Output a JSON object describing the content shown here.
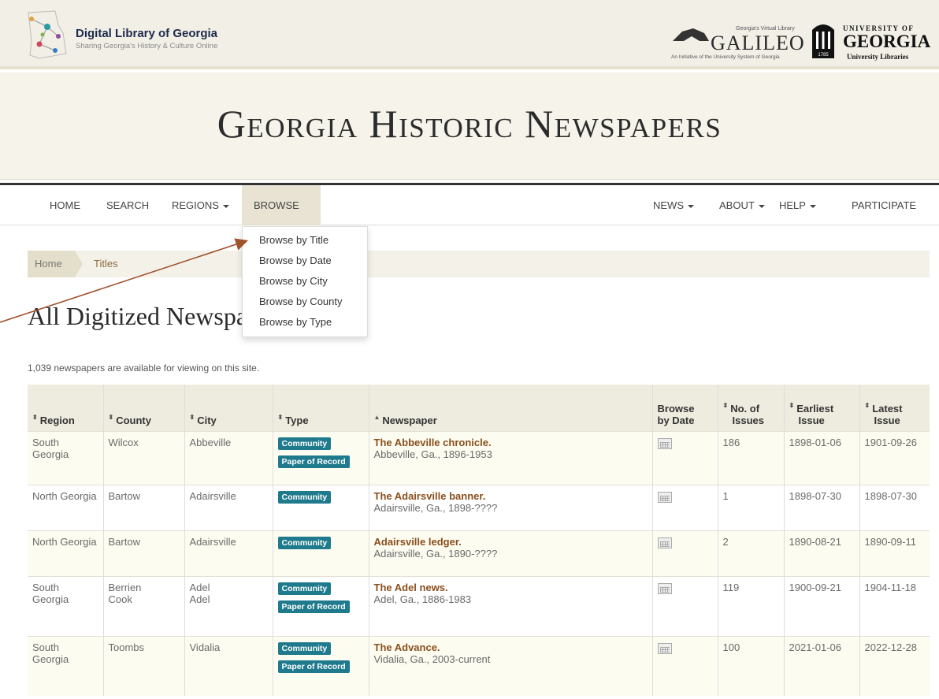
{
  "header": {
    "dlg_name": "Digital Library of Georgia",
    "dlg_tagline": "Sharing Georgia's History & Culture Online",
    "galileo_top": "Georgia's Virtual Library",
    "galileo_word": "GALILEO",
    "galileo_sub": "An Initiative of the University System of Georgia",
    "uga_univ": "UNIVERSITY OF",
    "uga_geo": "GEORGIA",
    "uga_lib": "University Libraries",
    "uga_year": "1785"
  },
  "banner": {
    "title": "Georgia Historic Newspapers"
  },
  "nav": {
    "left": [
      {
        "label": "HOME"
      },
      {
        "label": "SEARCH"
      },
      {
        "label": "REGIONS"
      },
      {
        "label": "BROWSE"
      }
    ],
    "right": [
      {
        "label": "NEWS"
      },
      {
        "label": "ABOUT"
      },
      {
        "label": "HELP"
      },
      {
        "label": "PARTICIPATE"
      }
    ],
    "browse_menu": [
      "Browse by Title",
      "Browse by Date",
      "Browse by City",
      "Browse by County",
      "Browse by Type"
    ]
  },
  "breadcrumb": {
    "home": "Home",
    "current": "Titles"
  },
  "page": {
    "title": "All Digitized Newspapers",
    "count_text": "1,039 newspapers are available for viewing on this site."
  },
  "table": {
    "headers": {
      "region": "Region",
      "county": "County",
      "city": "City",
      "type": "Type",
      "newspaper": "Newspaper",
      "browse_l1": "Browse",
      "browse_l2": "by Date",
      "issues_l1": "No. of",
      "issues_l2": "Issues",
      "earliest_l1": "Earliest",
      "earliest_l2": "Issue",
      "latest_l1": "Latest",
      "latest_l2": "Issue"
    },
    "badges": {
      "community": "Community",
      "record": "Paper of Record"
    },
    "rows": [
      {
        "region": "South Georgia",
        "county": "Wilcox",
        "city": "Abbeville",
        "title": "The Abbeville chronicle.",
        "sub": "Abbeville, Ga., 1896-1953",
        "issues": "186",
        "earliest": "1898-01-06",
        "latest": "1901-09-26"
      },
      {
        "region": "North Georgia",
        "county": "Bartow",
        "city": "Adairsville",
        "title": "The Adairsville banner.",
        "sub": "Adairsville, Ga., 1898-????",
        "issues": "1",
        "earliest": "1898-07-30",
        "latest": "1898-07-30"
      },
      {
        "region": "North Georgia",
        "county": "Bartow",
        "city": "Adairsville",
        "title": "Adairsville ledger.",
        "sub": "Adairsville, Ga., 1890-????",
        "issues": "2",
        "earliest": "1890-08-21",
        "latest": "1890-09-11"
      },
      {
        "region": "South Georgia",
        "county": "Berrien",
        "county2": "Cook",
        "city": "Adel",
        "city2": "Adel",
        "title": "The Adel news.",
        "sub": "Adel, Ga., 1886-1983",
        "issues": "119",
        "earliest": "1900-09-21",
        "latest": "1904-11-18"
      },
      {
        "region": "South Georgia",
        "county": "Toombs",
        "city": "Vidalia",
        "title": "The Advance.",
        "sub": "Vidalia, Ga., 2003-current",
        "issues": "100",
        "earliest": "2021-01-06",
        "latest": "2022-12-28"
      }
    ]
  },
  "colors": {
    "header_bg": "#f1efe6",
    "accent_link": "#8a4f1d",
    "badge_bg": "#1e7a8c",
    "arrow": "#a0522d"
  }
}
